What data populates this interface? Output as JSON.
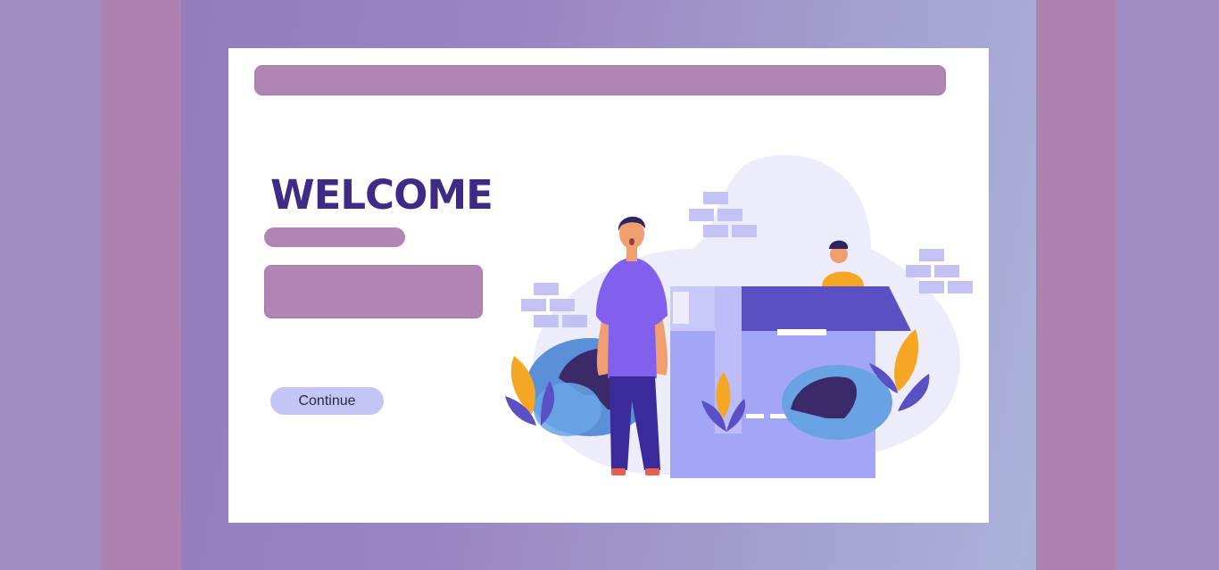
{
  "welcome": {
    "title": "WELCOME",
    "continue_label": "Continue"
  },
  "colors": {
    "background": "#9a85c2",
    "accent_bar": "#b085b3",
    "title": "#3f2b86",
    "button": "#c5c4f6",
    "illustration_primary": "#5b4fc4",
    "illustration_leaf": "#f5a623"
  },
  "icons": {
    "illustration": "house-moving-illustration"
  }
}
